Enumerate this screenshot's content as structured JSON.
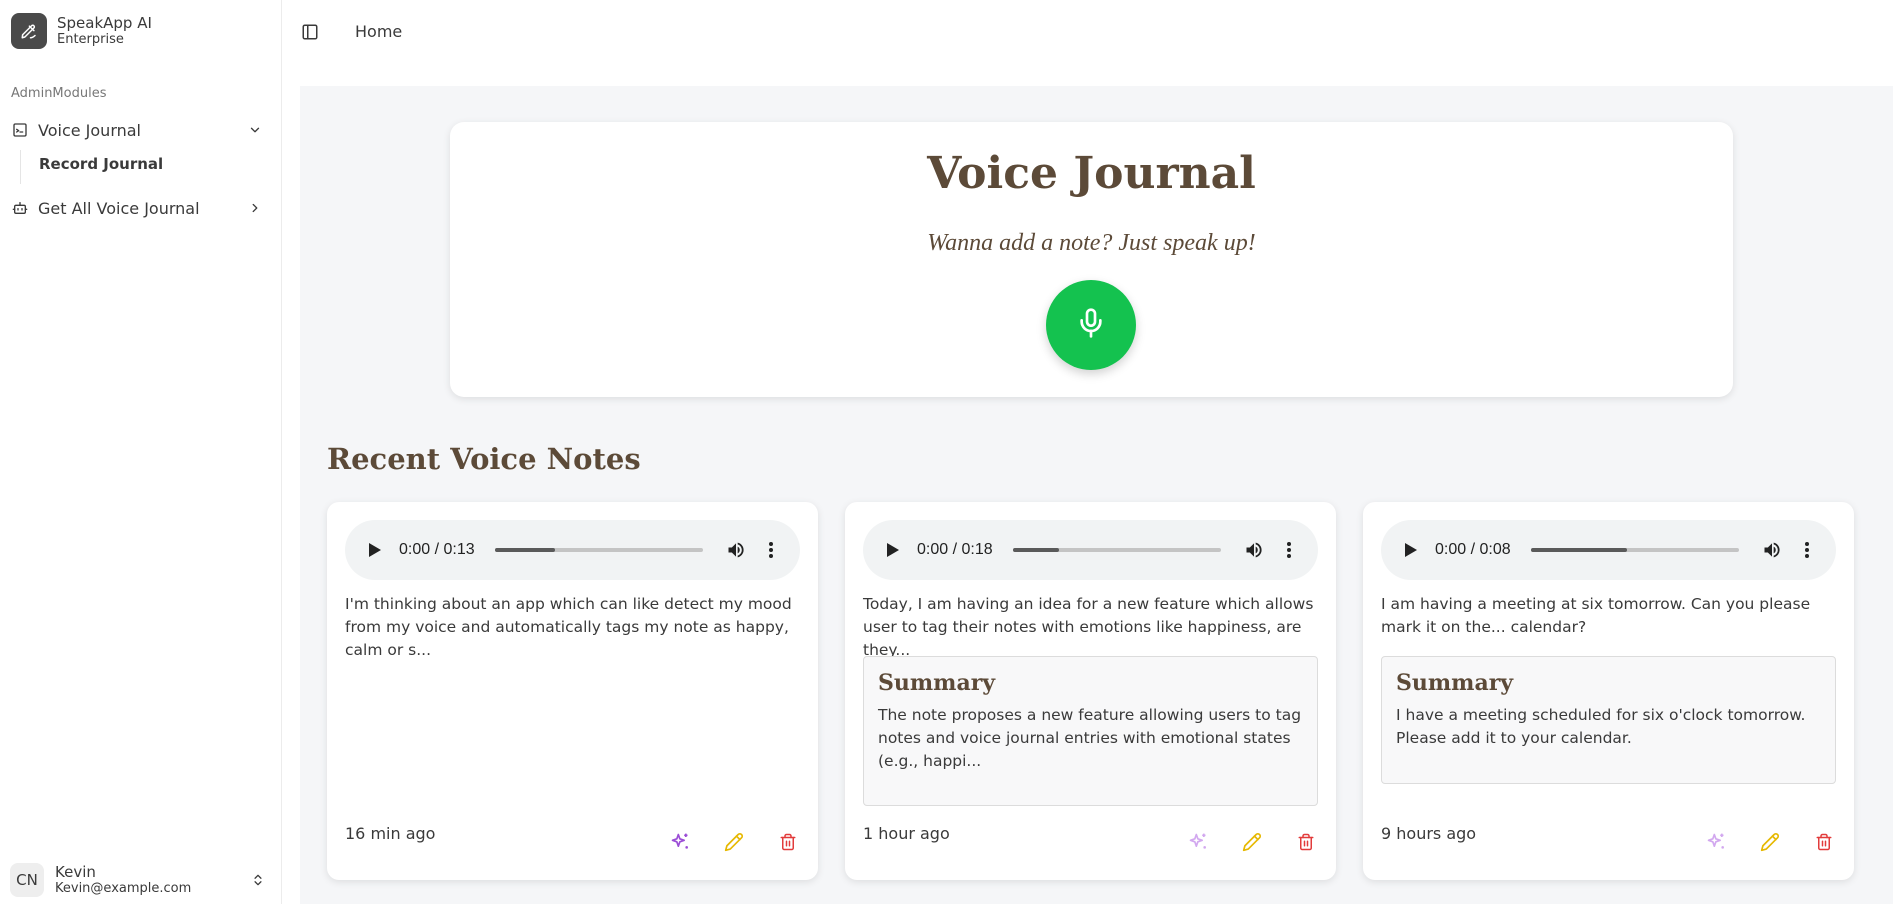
{
  "app": {
    "name": "SpeakApp AI",
    "plan": "Enterprise",
    "logo_icon": "pen-icon"
  },
  "sidebar": {
    "group_label": "AdminModules",
    "items": [
      {
        "label": "Voice Journal",
        "icon": "terminal-square-icon",
        "expanded": true,
        "children": [
          {
            "label": "Record Journal"
          }
        ]
      },
      {
        "label": "Get All Voice Journal",
        "icon": "bot-icon",
        "expanded": false
      }
    ]
  },
  "user": {
    "initials": "CN",
    "name": "Kevin",
    "email": "Kevin@example.com"
  },
  "header": {
    "breadcrumb": "Home"
  },
  "hero": {
    "title": "Voice Journal",
    "subtitle": "Wanna add a note? Just speak up!",
    "record_button_color": "#14c24f"
  },
  "recent": {
    "title": "Recent Voice Notes",
    "notes": [
      {
        "time": "0:00 / 0:13",
        "progress": 0.29,
        "text": "I'm thinking about an app which can like detect my mood from my voice and automatically tags my note as happy, calm or s...",
        "summary_title": "",
        "summary": "",
        "ago": "16 min ago"
      },
      {
        "time": "0:00 / 0:18",
        "progress": 0.22,
        "text": "Today, I am having an idea for a new feature which allows user to tag their notes with emotions like happiness, are they...",
        "summary_title": "Summary",
        "summary": "The note proposes a new feature allowing users to tag notes and voice journal entries with emotional states (e.g., happi...",
        "ago": "1 hour ago"
      },
      {
        "time": "0:00 / 0:08",
        "progress": 0.46,
        "text": "I am having a meeting at six tomorrow. Can you please mark it on the... calendar?",
        "summary_title": "Summary",
        "summary": "I have a meeting scheduled for six o'clock tomorrow. Please add it to your calendar.",
        "ago": "9 hours ago"
      }
    ]
  },
  "colors": {
    "accent_brown": "#5c4a38",
    "summarize_active": "#9b4dd6",
    "summarize_disabled": "#d2a8ef",
    "edit": "#e6b800",
    "delete": "#e23b3b"
  }
}
